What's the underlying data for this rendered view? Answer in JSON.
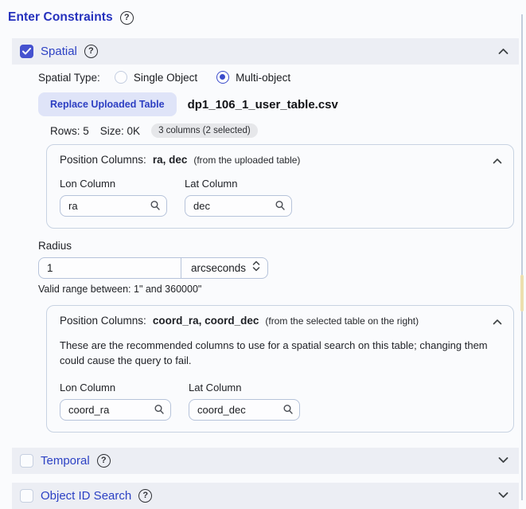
{
  "page": {
    "title": "Enter Constraints"
  },
  "spatial": {
    "label": "Spatial",
    "checked": true,
    "spatial_type_label": "Spatial Type:",
    "radio_options": [
      {
        "label": "Single Object",
        "selected": false
      },
      {
        "label": "Multi-object",
        "selected": true
      }
    ],
    "upload": {
      "replace_button": "Replace Uploaded Table",
      "filename": "dp1_106_1_user_table.csv",
      "rows": "Rows: 5",
      "size": "Size: 0K",
      "columns_badge": "3 columns (2 selected)"
    },
    "position_panel_upload": {
      "title": "Position Columns:",
      "columns": "ra, dec",
      "hint": "(from the uploaded table)",
      "lon_label": "Lon Column",
      "lon_value": "ra",
      "lat_label": "Lat Column",
      "lat_value": "dec"
    },
    "radius": {
      "label": "Radius",
      "value": "1",
      "unit": "arcseconds",
      "valid_range": "Valid range between: 1\" and 360000\""
    },
    "position_panel_table": {
      "title": "Position Columns:",
      "columns": "coord_ra, coord_dec",
      "hint": "(from the selected table on the right)",
      "description": "These are the recommended columns to use for a spatial search on this table; changing them could cause the query to fail.",
      "lon_label": "Lon Column",
      "lon_value": "coord_ra",
      "lat_label": "Lat Column",
      "lat_value": "coord_dec"
    }
  },
  "temporal": {
    "label": "Temporal",
    "checked": false
  },
  "object_id": {
    "label": "Object ID Search",
    "checked": false
  },
  "colors": {
    "accent_blue": "#2c41c4",
    "checkbox_fill": "#4552cf",
    "section_bar_bg": "#eceef4",
    "button_bg": "#dfe4f8",
    "panel_border": "#c8d3e2",
    "badge_bg": "#e6e7ea",
    "divider_highlight": "#ecdfae"
  }
}
